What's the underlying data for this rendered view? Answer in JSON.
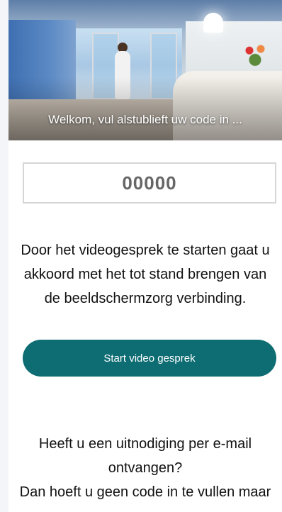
{
  "hero": {
    "caption": "Welkom, vul alstublieft uw code in ..."
  },
  "code_field": {
    "placeholder": "00000"
  },
  "consent": {
    "text": "Door het videogesprek te starten gaat u akkoord met het tot stand brengen van de beeldschermzorg verbinding."
  },
  "start_button": {
    "label": "Start video gesprek"
  },
  "invite": {
    "question": "Heeft u een uitnodiging per e-mail ontvangen?",
    "line": "Dan hoeft u geen code in te vullen maar"
  },
  "colors": {
    "accent": "#0e6d73",
    "background": "#f3f5f8",
    "text": "#111111"
  }
}
